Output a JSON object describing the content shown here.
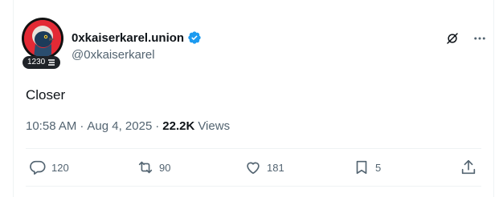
{
  "author": {
    "display_name": "0xkaiserkarel.union",
    "handle": "@0xkaiserkarel",
    "verified": true,
    "badge_count": "1230",
    "avatar_bg": "#e32a35"
  },
  "post": {
    "text": "Closer",
    "time": "10:58 AM",
    "separator": "·",
    "date": "Aug 4, 2025",
    "views_count": "22.2K",
    "views_label": "Views"
  },
  "actions": {
    "reply_count": "120",
    "repost_count": "90",
    "like_count": "181",
    "bookmark_count": "5"
  },
  "icons": {
    "top": [
      "grok-icon",
      "more-icon"
    ],
    "action_bar": [
      "reply-icon",
      "repost-icon",
      "like-icon",
      "bookmark-icon",
      "share-icon"
    ]
  },
  "colors": {
    "text_primary": "#0f1419",
    "text_secondary": "#536471",
    "verified_blue": "#1d9bf0",
    "divider": "#eff3f4"
  }
}
